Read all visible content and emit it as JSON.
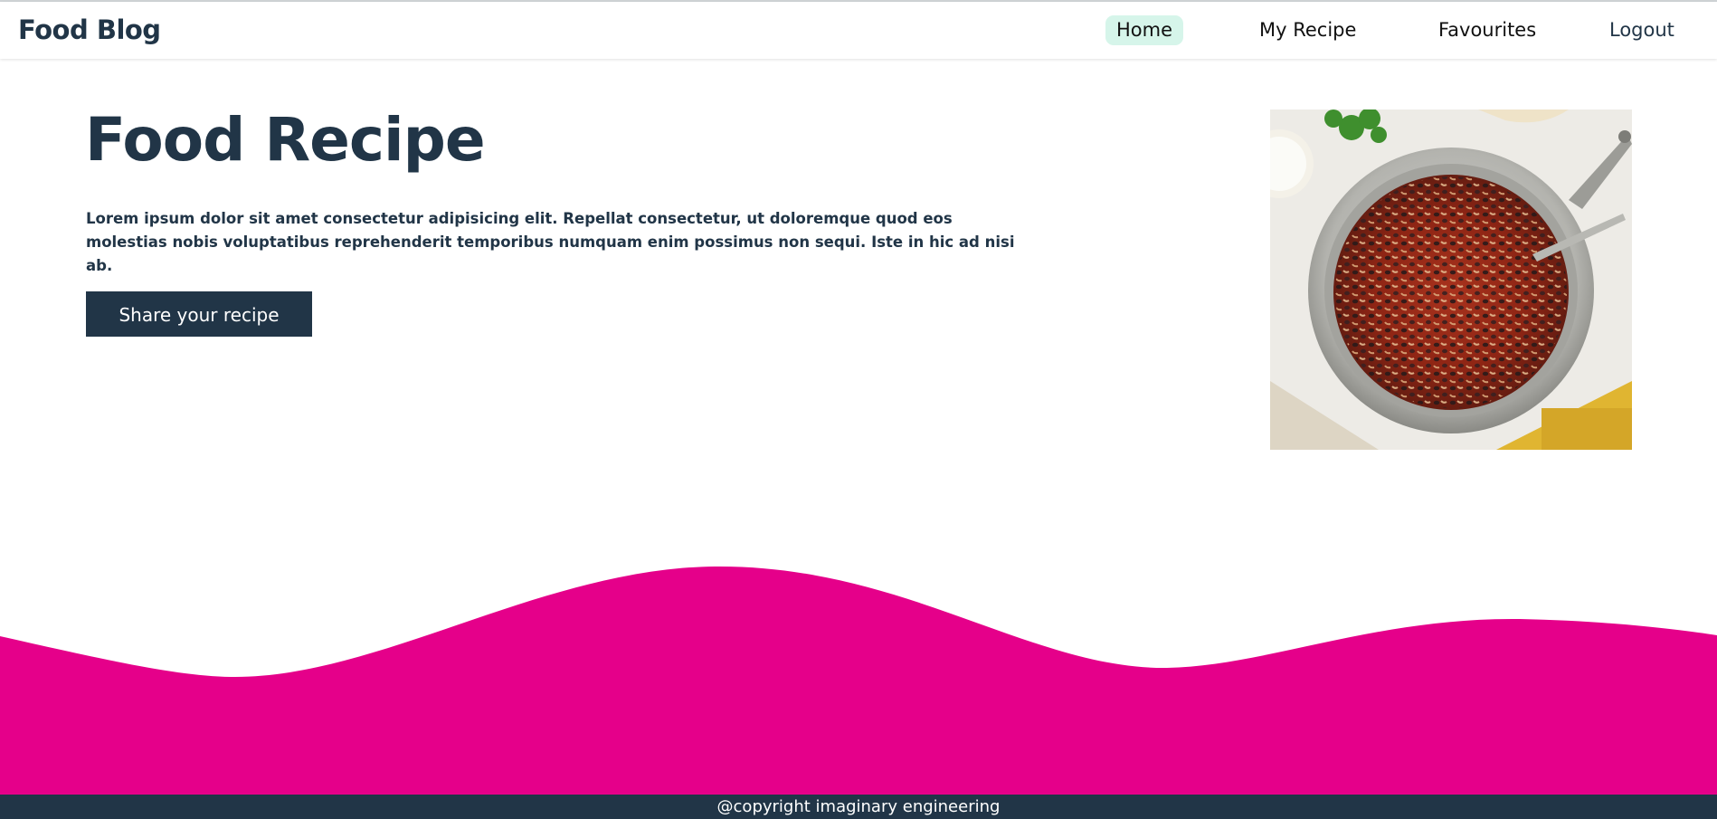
{
  "header": {
    "brand": "Food Blog",
    "nav": {
      "home": "Home",
      "my_recipe": "My Recipe",
      "favourites": "Favourites",
      "logout": "Logout"
    },
    "active_tab": "Home"
  },
  "hero": {
    "title": "Food Recipe",
    "description": "Lorem ipsum dolor sit amet consectetur adipisicing elit. Repellat consectetur, ut doloremque quod eos molestias nobis voluptatibus reprehenderit temporibus numquam enim possimus non sequi. Iste in hic ad nisi ab.",
    "button_label": "Share your recipe"
  },
  "footer": {
    "copyright": "@copyright imaginary engineering"
  },
  "colors": {
    "brand_dark": "#213547",
    "active_tab_bg": "#d6f5ea",
    "wave_pink": "#e5008a"
  }
}
